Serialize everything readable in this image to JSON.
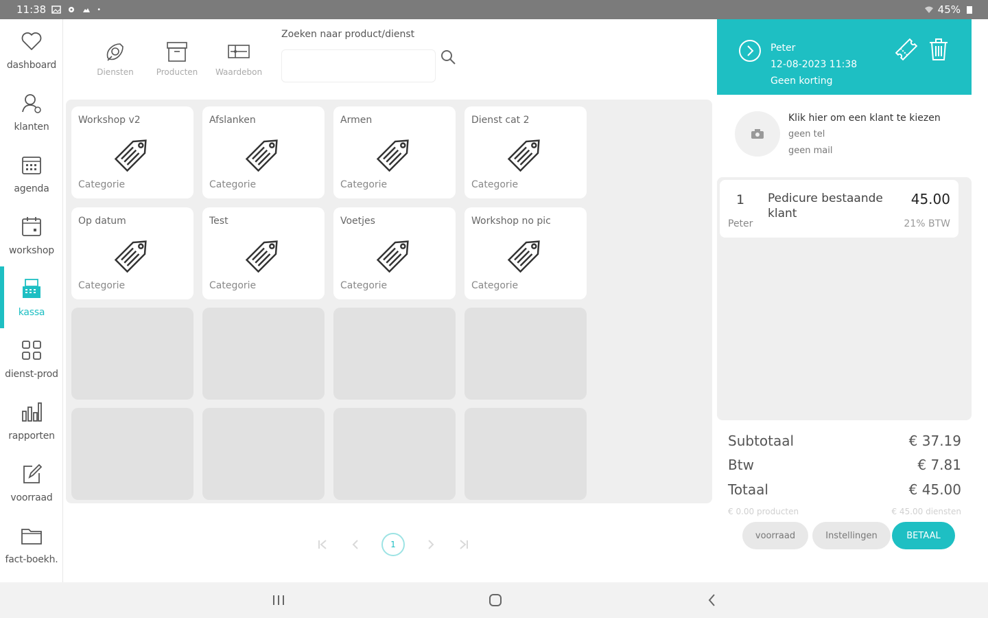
{
  "status_bar": {
    "time": "11:38",
    "battery": "45%"
  },
  "sidebar": {
    "items": [
      {
        "label": "dashboard",
        "icon": "heart-icon"
      },
      {
        "label": "klanten",
        "icon": "user-icon"
      },
      {
        "label": "agenda",
        "icon": "calendar-icon"
      },
      {
        "label": "workshop",
        "icon": "calendar-blank-icon"
      },
      {
        "label": "kassa",
        "icon": "register-icon",
        "active": true
      },
      {
        "label": "dienst-prod",
        "icon": "grid-icon"
      },
      {
        "label": "rapporten",
        "icon": "bar-chart-icon"
      },
      {
        "label": "voorraad",
        "icon": "edit-icon"
      },
      {
        "label": "fact-boekh.",
        "icon": "folder-icon"
      }
    ]
  },
  "toolbar": {
    "services_label": "Diensten",
    "products_label": "Producten",
    "vouchers_label": "Waardebon",
    "search_label": "Zoeken naar product/dienst",
    "search_value": ""
  },
  "tiles": [
    {
      "name": "Workshop v2",
      "category": "Categorie"
    },
    {
      "name": "Afslanken",
      "category": "Categorie"
    },
    {
      "name": "Armen",
      "category": "Categorie"
    },
    {
      "name": "Dienst cat 2",
      "category": "Categorie"
    },
    {
      "name": "Op datum",
      "category": "Categorie"
    },
    {
      "name": "Test",
      "category": "Categorie"
    },
    {
      "name": "Voetjes",
      "category": "Categorie"
    },
    {
      "name": "Workshop no pic",
      "category": "Categorie"
    }
  ],
  "pagination": {
    "current_page": "1"
  },
  "order": {
    "employee": "Peter",
    "datetime": "12-08-2023 11:38",
    "discount": "Geen korting"
  },
  "customer": {
    "prompt": "Klik hier om een klant te kiezen",
    "phone": "geen tel",
    "mail": "geen mail"
  },
  "order_lines": [
    {
      "qty": "1",
      "name": "Pedicure bestaande klant",
      "price": "45.00",
      "employee": "Peter",
      "vat": "21% BTW"
    }
  ],
  "totals": {
    "subtotal_label": "Subtotaal",
    "subtotal_value": "€ 37.19",
    "vat_label": "Btw",
    "vat_value": "€ 7.81",
    "total_label": "Totaal",
    "total_value": "€ 45.00",
    "products_note": "€ 0.00 producten",
    "services_note": "€ 45.00 diensten"
  },
  "actions": {
    "stock_label": "voorraad",
    "settings_label": "Instellingen",
    "pay_label": "BETAAL"
  },
  "colors": {
    "accent": "#1ebfc3",
    "panel": "#efefef",
    "empty_tile": "#e1e1e1"
  }
}
